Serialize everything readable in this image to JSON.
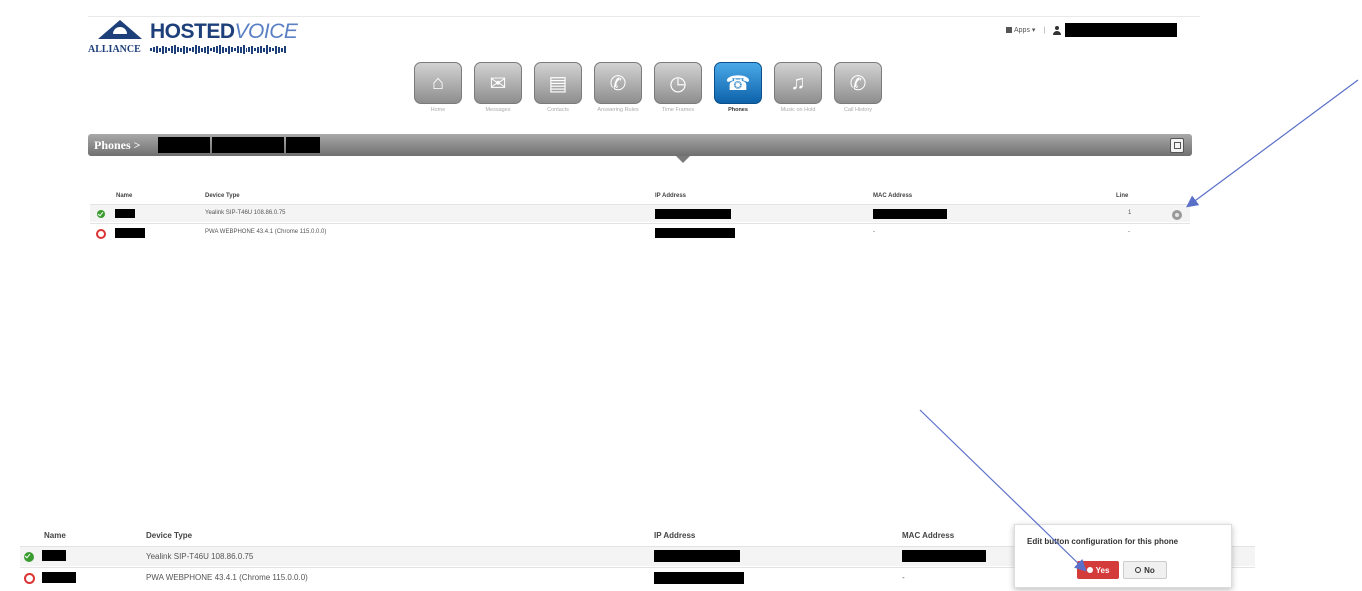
{
  "logo": {
    "brand_bold": "HOSTED",
    "brand_light": "VOICE",
    "sub": "ALLIANCE"
  },
  "topright": {
    "menu_label": "Apps ▾"
  },
  "nav": {
    "items": [
      {
        "label": "Home",
        "icon": "home-icon",
        "glyph": "⌂"
      },
      {
        "label": "Messages",
        "icon": "envelope-icon",
        "glyph": "✉"
      },
      {
        "label": "Contacts",
        "icon": "contacts-icon",
        "glyph": "▤"
      },
      {
        "label": "Answering Rules",
        "icon": "phone-rules-icon",
        "glyph": "✆"
      },
      {
        "label": "Time Frames",
        "icon": "clock-icon",
        "glyph": "◷"
      },
      {
        "label": "Phones",
        "icon": "handset-icon",
        "glyph": "☎"
      },
      {
        "label": "Music on Hold",
        "icon": "music-icon",
        "glyph": "♫"
      },
      {
        "label": "Call History",
        "icon": "call-history-icon",
        "glyph": "✆"
      }
    ],
    "active_index": 5
  },
  "bar": {
    "title": "Phones >"
  },
  "table": {
    "headers": [
      "Name",
      "Device Type",
      "IP Address",
      "MAC Address",
      "Line"
    ],
    "rows": [
      {
        "status": "ok",
        "device_type": "Yealink SIP-T46U 108.86.0.75",
        "mac": "",
        "line": "1"
      },
      {
        "status": "error",
        "device_type": "PWA WEBPHONE 43.4.1 (Chrome 115.0.0.0)",
        "mac": "-",
        "line": "-"
      }
    ]
  },
  "table_zoom": {
    "headers": [
      "Name",
      "Device Type",
      "IP Address",
      "MAC Address"
    ],
    "rows": [
      {
        "status": "ok",
        "device_type": "Yealink SIP-T46U 108.86.0.75",
        "mac": ""
      },
      {
        "status": "error",
        "device_type": "PWA WEBPHONE 43.4.1 (Chrome 115.0.0.0)",
        "mac": "-"
      }
    ]
  },
  "popover": {
    "title": "Edit button configuration for this phone",
    "yes_label": "Yes",
    "no_label": "No"
  },
  "colors": {
    "brand": "#1d3f7a",
    "active_nav": "#1a7fcf",
    "ok": "#3a9c2f",
    "error": "#d33333",
    "arrow": "#5a6fc8"
  }
}
